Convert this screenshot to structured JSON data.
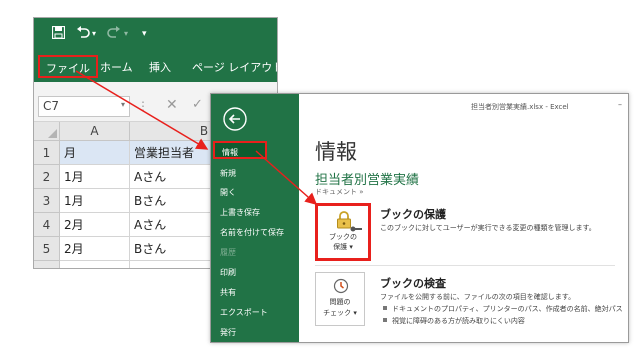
{
  "excel": {
    "qat": {
      "save_icon": "save-icon",
      "undo_icon": "undo-icon",
      "redo_icon": "redo-icon",
      "customize_icon": "customize-qat-icon"
    },
    "tabs": [
      {
        "label": "ファイル"
      },
      {
        "label": "ホーム"
      },
      {
        "label": "挿入"
      },
      {
        "label": "ページ レイアウト"
      }
    ],
    "namebox": "C7",
    "grid": {
      "columns": [
        "A",
        "B"
      ],
      "rows": [
        {
          "num": "1",
          "a": "月",
          "b": "営業担当者"
        },
        {
          "num": "2",
          "a": "1月",
          "b": "Aさん"
        },
        {
          "num": "3",
          "a": "1月",
          "b": "Bさん"
        },
        {
          "num": "4",
          "a": "2月",
          "b": "Aさん"
        },
        {
          "num": "5",
          "a": "2月",
          "b": "Bさん"
        }
      ]
    }
  },
  "backstage": {
    "window_title": "担当者別営業実績.xlsx - Excel",
    "sidebar": [
      {
        "label": "情報"
      },
      {
        "label": "新規"
      },
      {
        "label": "開く"
      },
      {
        "label": "上書き保存"
      },
      {
        "label": "名前を付けて保存"
      },
      {
        "label": "履歴"
      },
      {
        "label": "印刷"
      },
      {
        "label": "共有"
      },
      {
        "label": "エクスポート"
      },
      {
        "label": "発行"
      }
    ],
    "heading": "情報",
    "file_name": "担当者別営業実績",
    "path": "ドキュメント »",
    "protect": {
      "button_line1": "ブックの",
      "button_line2": "保護 ▾",
      "title": "ブックの保護",
      "desc": "このブックに対してユーザーが実行できる変更の種類を管理します。"
    },
    "inspect": {
      "button_line1": "問題の",
      "button_line2": "チェック ▾",
      "title": "ブックの検査",
      "desc": "ファイルを公開する前に、ファイルの次の項目を確認します。",
      "bullets": [
        "ドキュメントのプロパティ、プリンターのパス、作成者の名前、絶対パス",
        "視覚に障碍のある方が読み取りにくい内容"
      ]
    }
  },
  "colors": {
    "excel_green": "#217346",
    "highlight_red": "#e8201c",
    "active_side": "#0e5c2f"
  }
}
